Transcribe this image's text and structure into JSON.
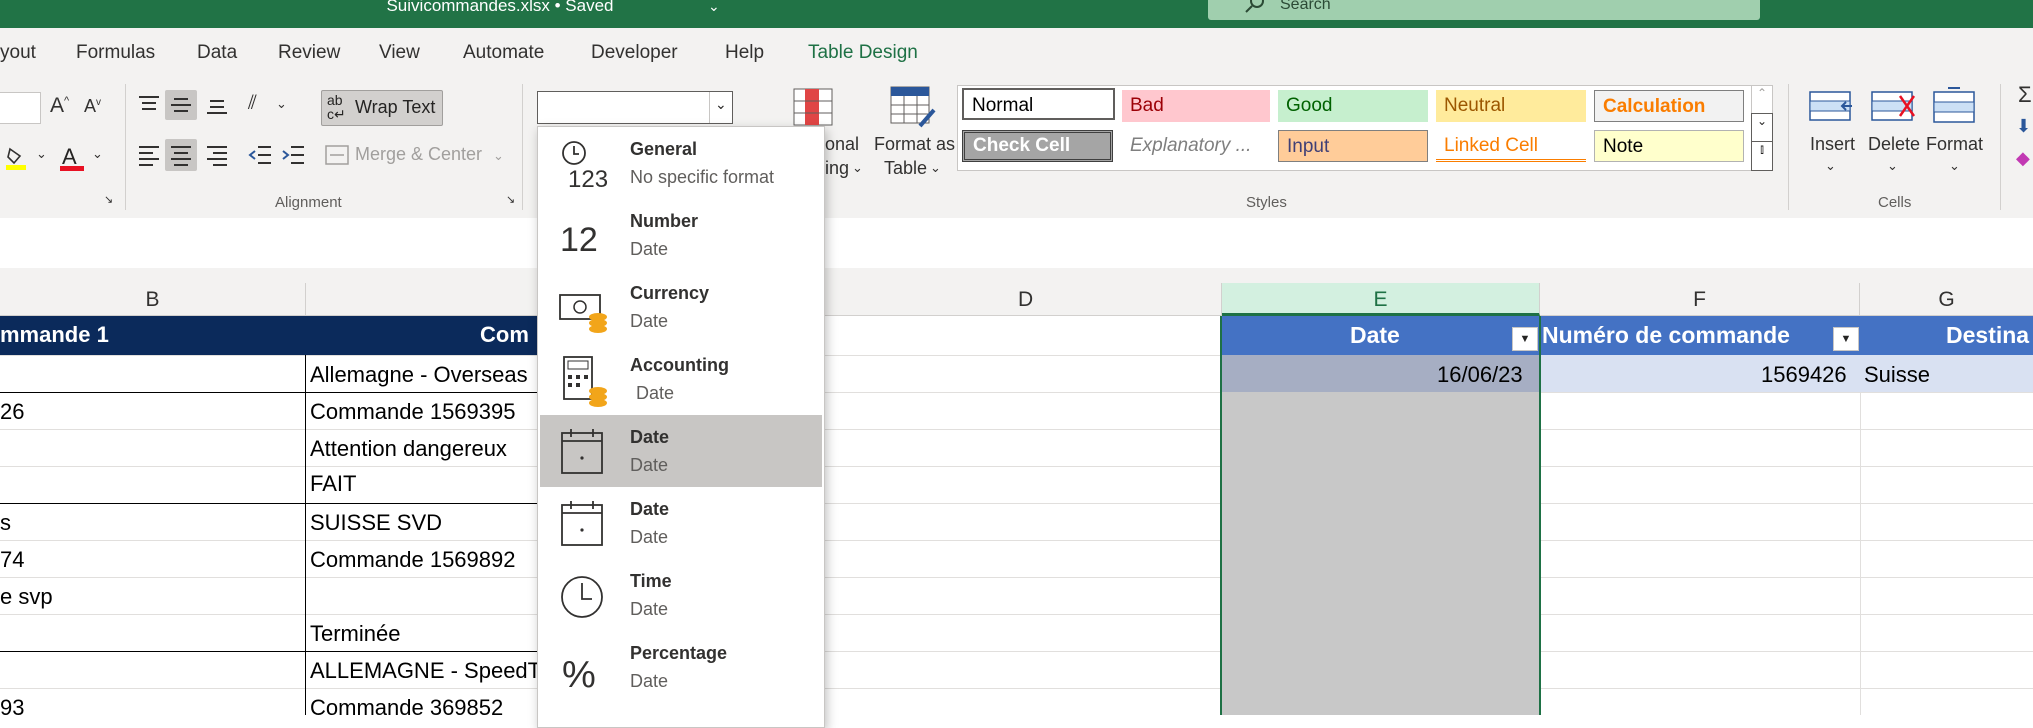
{
  "titlebar": {
    "doc_title": "Suivicommandes.xlsx • Saved",
    "search_placeholder": "Search"
  },
  "menu_tabs": [
    "yout",
    "Formulas",
    "Data",
    "Review",
    "View",
    "Automate",
    "Developer",
    "Help",
    "Table Design"
  ],
  "ribbon": {
    "wrap_text": "Wrap Text",
    "merge_center": "Merge & Center",
    "alignment_label": "Alignment",
    "cond_fmt_line1": "onal",
    "cond_fmt_line2": "ing",
    "format_as_table_line1": "Format as",
    "format_as_table_line2": "Table",
    "styles_label": "Styles",
    "styles": [
      {
        "label": "Normal",
        "bg": "#ffffff",
        "color": "#000000"
      },
      {
        "label": "Bad",
        "bg": "#ffc7ce",
        "color": "#9c0006"
      },
      {
        "label": "Good",
        "bg": "#c6efce",
        "color": "#006100"
      },
      {
        "label": "Neutral",
        "bg": "#ffeb9c",
        "color": "#9c5700"
      },
      {
        "label": "Calculation",
        "bg": "#f2f2f2",
        "color": "#fa7d00"
      },
      {
        "label": "Check Cell",
        "bg": "#a5a5a5",
        "color": "#ffffff"
      },
      {
        "label": "Explanatory ...",
        "bg": "#ffffff",
        "color": "#7f7f7f"
      },
      {
        "label": "Input",
        "bg": "#ffcc99",
        "color": "#3f3f76"
      },
      {
        "label": "Linked Cell",
        "bg": "#ffffff",
        "color": "#fa7d00"
      },
      {
        "label": "Note",
        "bg": "#ffffcc",
        "color": "#000000"
      }
    ],
    "insert": "Insert",
    "delete": "Delete",
    "format": "Format",
    "cells_label": "Cells"
  },
  "number_format": {
    "combo_value": "",
    "items": [
      {
        "title": "General",
        "sub": "No specific format",
        "icon": "clock-123-icon"
      },
      {
        "title": "Number",
        "sub": "Date",
        "icon": "number-12-icon"
      },
      {
        "title": "Currency",
        "sub": "Date",
        "icon": "currency-icon"
      },
      {
        "title": "Accounting",
        "sub": "Date",
        "icon": "accounting-icon"
      },
      {
        "title": "Date",
        "sub": "Date",
        "icon": "calendar-icon"
      },
      {
        "title": "Date",
        "sub": "Date",
        "icon": "calendar-icon"
      },
      {
        "title": "Time",
        "sub": "Date",
        "icon": "clock-icon"
      },
      {
        "title": "Percentage",
        "sub": "Date",
        "icon": "percent-icon"
      }
    ],
    "selected_index": 4
  },
  "grid": {
    "columns": [
      "B",
      "D",
      "E",
      "F",
      "G"
    ],
    "header_b": "mmande 1",
    "header_c": "Com",
    "header_e": "Date",
    "header_f": "Numéro de commande",
    "header_g": "Destina",
    "col_b": [
      "",
      "26",
      "",
      "",
      "s",
      "74",
      "e svp",
      "",
      "",
      "93"
    ],
    "col_c": [
      "Allemagne - Overseas",
      "Commande 1569395",
      "Attention dangereux",
      "FAIT",
      "SUISSE SVD",
      "Commande 1569892",
      "",
      "Terminée",
      "ALLEMAGNE - SpeedT",
      "Commande 369852"
    ],
    "e_row1": "16/06/23",
    "f_row1": "1569426",
    "g_row1": "Suisse"
  }
}
